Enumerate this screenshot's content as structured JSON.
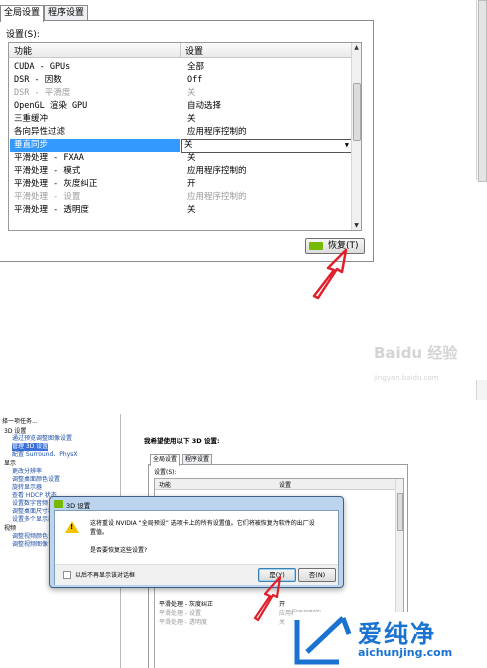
{
  "top": {
    "tabs": [
      "全局设置",
      "程序设置"
    ],
    "settings_label": "设置(S):",
    "columns": [
      "功能",
      "设置"
    ],
    "rows": [
      {
        "feature": "CUDA - GPUs",
        "value": "全部"
      },
      {
        "feature": "DSR - 因数",
        "value": "Off"
      },
      {
        "feature": "DSR - 平滑度",
        "value": "关"
      },
      {
        "feature": "OpenGL 渲染 GPU",
        "value": "自动选择"
      },
      {
        "feature": "三重缓冲",
        "value": "关"
      },
      {
        "feature": "各向异性过滤",
        "value": "应用程序控制的"
      },
      {
        "feature": "垂直同步",
        "value": "关"
      },
      {
        "feature": "平滑处理 - FXAA",
        "value": "关"
      },
      {
        "feature": "平滑处理 - 模式",
        "value": "应用程序控制的"
      },
      {
        "feature": "平滑处理 - 灰度纠正",
        "value": "开"
      },
      {
        "feature": "平滑处理 - 设置",
        "value": "应用程序控制的"
      },
      {
        "feature": "平滑处理 - 透明度",
        "value": "关"
      }
    ],
    "restore_button": "恢复(T)",
    "watermark": "Baidu 经验",
    "watermark_url": "jingyan.baidu.com"
  },
  "bottom": {
    "tree": {
      "title": "择一项任务...",
      "items": [
        {
          "label": "3D 设置",
          "type": "group"
        },
        {
          "label": "通过预览调整图像设置",
          "type": "link"
        },
        {
          "label": "管理 3D 设置",
          "type": "selected"
        },
        {
          "label": "配置 Surround、PhysX",
          "type": "link"
        },
        {
          "label": "显示",
          "type": "group"
        },
        {
          "label": "更改分辨率",
          "type": "link"
        },
        {
          "label": "调整桌面颜色设置",
          "type": "link"
        },
        {
          "label": "旋转显示器",
          "type": "link"
        },
        {
          "label": "查看 HDCP 状态",
          "type": "link"
        },
        {
          "label": "设置数字音频",
          "type": "link"
        },
        {
          "label": "调整桌面尺寸和位置",
          "type": "link"
        },
        {
          "label": "设置多个显示器",
          "type": "link"
        },
        {
          "label": "视频",
          "type": "group"
        },
        {
          "label": "调整视频颜色设置",
          "type": "link"
        },
        {
          "label": "调整视频图像设置",
          "type": "link"
        }
      ]
    },
    "heading": "我希望使用以下 3D 设置:",
    "tabs": [
      "全局设置",
      "程序设置"
    ],
    "settings_label": "设置(S):",
    "columns": [
      "功能",
      "设置"
    ],
    "visible_rows": [
      {
        "feature": "平滑处理 - 灰度纠正",
        "value": "开"
      },
      {
        "feature": "平滑处理 - 设置",
        "value": "应用程序控制的"
      },
      {
        "feature": "平滑处理 - 透明度",
        "value": "关"
      }
    ],
    "dialog": {
      "title": "3D 设置",
      "message": "这将重设 NVIDIA “全局预设” 选项卡上的所有设置值。它们将被恢复为软件的出厂设置值。",
      "question": "是否要恢复这些设置?",
      "checkbox_label": "以后不再显示该对话框",
      "yes_button": "是(Y)",
      "no_button": "否(N)"
    },
    "logo_text": "爱纯净",
    "logo_url": "aichunjing.com"
  },
  "colors": {
    "selection": "#3399ff",
    "arrow": "#e0202a",
    "nvidia_green": "#76b900",
    "logo_blue": "#1a73d1"
  }
}
